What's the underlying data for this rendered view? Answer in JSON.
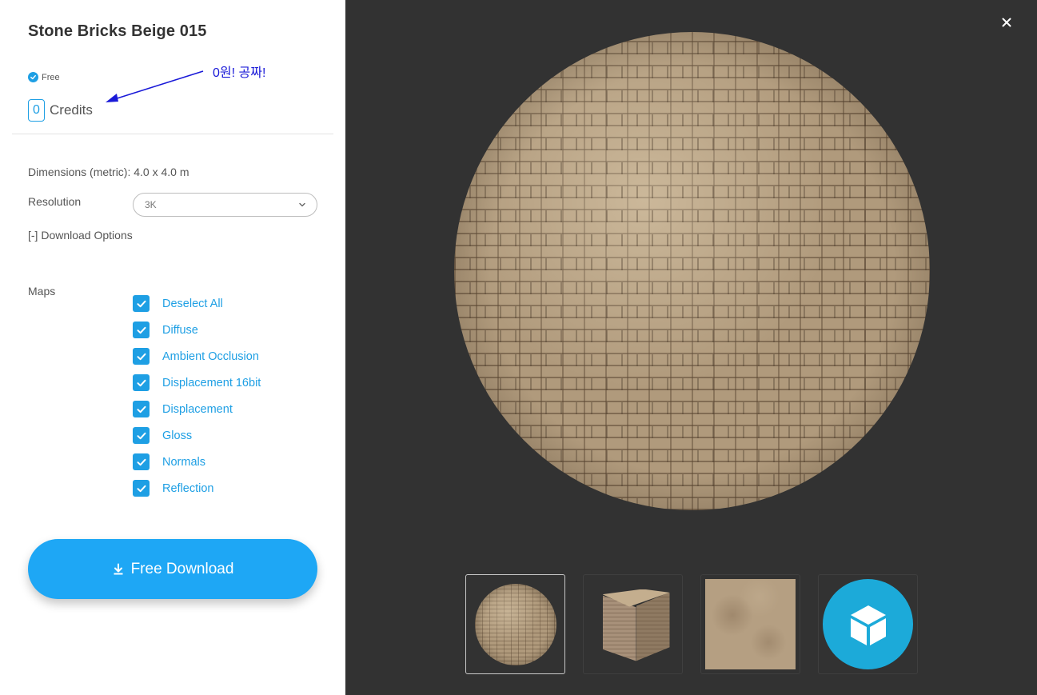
{
  "product": {
    "title": "Stone Bricks Beige 015",
    "price_tag": "Free",
    "credits_value": "0",
    "credits_label": "Credits"
  },
  "annotation": {
    "text": "0원! 공짜!",
    "color": "#1a1ad8"
  },
  "details": {
    "dimensions": "Dimensions (metric): 4.0 x 4.0 m",
    "resolution_label": "Resolution",
    "resolution_value": "3K",
    "download_options_label": "[-] Download Options"
  },
  "maps": {
    "label": "Maps",
    "items": [
      {
        "label": "Deselect All",
        "checked": true
      },
      {
        "label": "Diffuse",
        "checked": true
      },
      {
        "label": "Ambient Occlusion",
        "checked": true
      },
      {
        "label": "Displacement 16bit",
        "checked": true
      },
      {
        "label": "Displacement",
        "checked": true
      },
      {
        "label": "Gloss",
        "checked": true
      },
      {
        "label": "Normals",
        "checked": true
      },
      {
        "label": "Reflection",
        "checked": true
      }
    ]
  },
  "actions": {
    "download_label": "Free Download"
  },
  "preview": {
    "active_thumbnail": "sphere",
    "thumbnails": [
      "sphere",
      "cube",
      "flat-texture",
      "sketchfab-3d-viewer"
    ]
  },
  "icons": {
    "close": "close-icon",
    "download": "download-icon",
    "chevron": "chevron-down-icon",
    "verified": "check-circle-icon",
    "checkbox": "checkmark-icon",
    "sketchfab": "sketchfab-cube-icon"
  },
  "colors": {
    "accent": "#1e9fe4",
    "button": "#1ea7f5",
    "preview_bg": "#323232",
    "sketchfab": "#1caad9"
  }
}
